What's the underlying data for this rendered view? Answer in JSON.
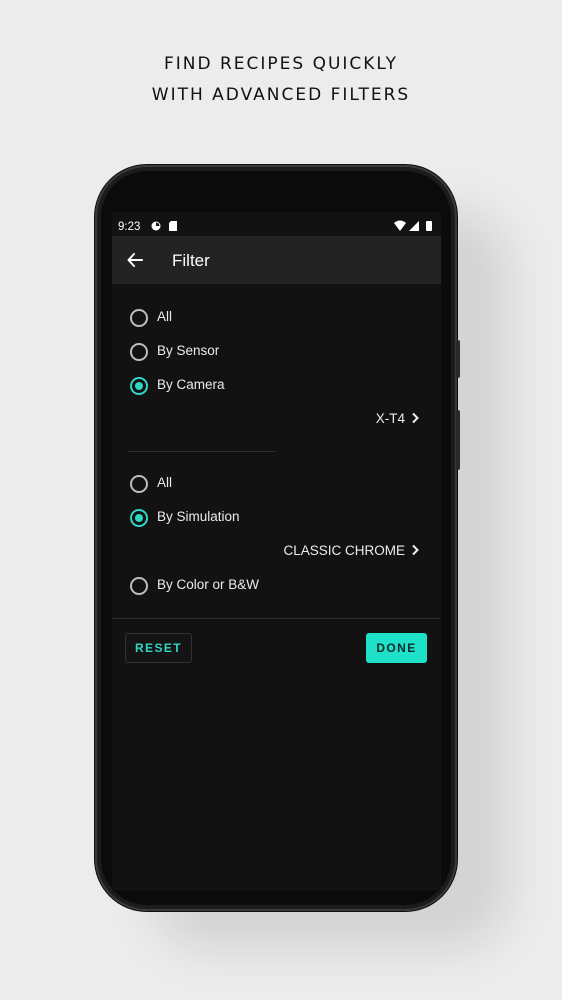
{
  "promo": {
    "line1": "FIND RECIPES QUICKLY",
    "line2": "WITH ADVANCED FILTERS"
  },
  "status_bar": {
    "time": "9:23",
    "icons_left": [
      "cloud-sync-icon",
      "sd-card-icon"
    ],
    "icons_right": [
      "wifi-icon",
      "cellular-signal-icon",
      "battery-icon"
    ]
  },
  "toolbar": {
    "title": "Filter",
    "back_icon": "arrow-left-icon"
  },
  "sensor_group": {
    "options": [
      {
        "label": "All",
        "selected": false
      },
      {
        "label": "By Sensor",
        "selected": false
      },
      {
        "label": "By Camera",
        "selected": true
      }
    ],
    "camera_value": "X-T4"
  },
  "simulation_group": {
    "options": [
      {
        "label": "All",
        "selected": false
      },
      {
        "label": "By Simulation",
        "selected": true
      },
      {
        "label": "By Color or B&W",
        "selected": false
      }
    ],
    "simulation_value": "CLASSIC CHROME"
  },
  "actions": {
    "reset_label": "RESET",
    "done_label": "DONE"
  },
  "colors": {
    "accent": "#2fd6c3",
    "button_done_bg": "#1fe0c9",
    "screen_bg": "#121212",
    "toolbar_bg": "#232323"
  }
}
